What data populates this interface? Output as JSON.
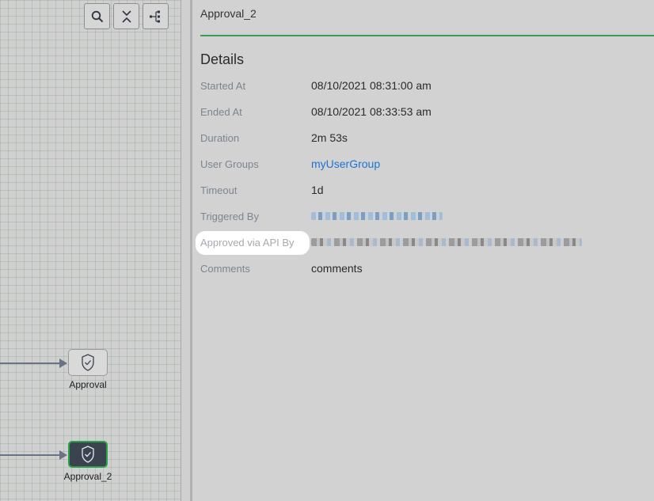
{
  "canvas": {
    "toolbar": [
      {
        "name": "search-button",
        "icon": "search-icon"
      },
      {
        "name": "collapse-button",
        "icon": "collapse-icon"
      },
      {
        "name": "layout-button",
        "icon": "tree-layout-icon"
      }
    ],
    "nodes": [
      {
        "label": "Approval",
        "state": "default",
        "icon": "shield-check-icon"
      },
      {
        "label": "Approval_2",
        "state": "selected",
        "icon": "shield-check-icon"
      }
    ]
  },
  "panel": {
    "title": "Approval_2",
    "section_title": "Details",
    "fields": [
      {
        "label": "Started At",
        "value": "08/10/2021 08:31:00 am"
      },
      {
        "label": "Ended At",
        "value": "08/10/2021 08:33:53 am"
      },
      {
        "label": "Duration",
        "value": "2m 53s"
      },
      {
        "label": "User Groups",
        "value": "myUserGroup"
      },
      {
        "label": "Timeout",
        "value": "1d"
      },
      {
        "label": "Triggered By",
        "value": ""
      },
      {
        "label": "Approved via API By",
        "value": ""
      },
      {
        "label": "Comments",
        "value": "comments"
      }
    ]
  },
  "colors": {
    "accent_green": "#3d9a55",
    "link_blue": "#1e73d2",
    "node_selected_bg": "#3b4250"
  }
}
